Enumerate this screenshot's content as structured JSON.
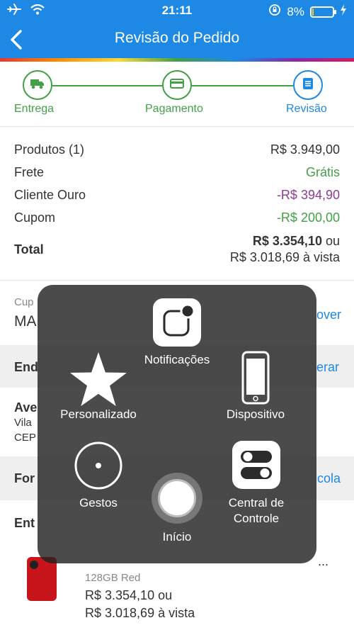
{
  "status_bar": {
    "time": "21:11",
    "battery": "8%",
    "battery_level": 0.08
  },
  "header": {
    "title": "Revisão do Pedido"
  },
  "steps": [
    {
      "label": "Entrega"
    },
    {
      "label": "Pagamento"
    },
    {
      "label": "Revisão"
    }
  ],
  "summary": {
    "products_label": "Produtos (1)",
    "products_value": "R$ 3.949,00",
    "shipping_label": "Frete",
    "shipping_value": "Grátis",
    "gold_label": "Cliente Ouro",
    "gold_value": "-R$ 394,90",
    "coupon_label": "Cupom",
    "coupon_value": "-R$ 200,00",
    "total_label": "Total",
    "total_value": "R$ 3.354,10",
    "total_or": "ou",
    "total_cash": "R$ 3.018,69 à vista"
  },
  "coupon_section": {
    "label": "Cup",
    "code": "MA",
    "action": "over"
  },
  "address_header": {
    "label": "End",
    "action": "erar"
  },
  "address": {
    "line1": "Ave",
    "line2": "Vila",
    "line3": "CEP"
  },
  "payment_header": {
    "label": "For",
    "action": "cola"
  },
  "delivery": {
    "label": "Ent"
  },
  "product": {
    "name_tail": "...",
    "variant": "128GB Red",
    "price": "R$ 3.354,10 ou",
    "cash_price": "R$ 3.018,69 à vista"
  },
  "assistive_touch": {
    "notifications": "Notificações",
    "custom": "Personalizado",
    "device": "Dispositivo",
    "gestures": "Gestos",
    "home": "Início",
    "control_center": "Central de\nControle"
  },
  "colors": {
    "primary": "#1e88e5",
    "green": "#43a047",
    "purple": "#8e3b96"
  }
}
